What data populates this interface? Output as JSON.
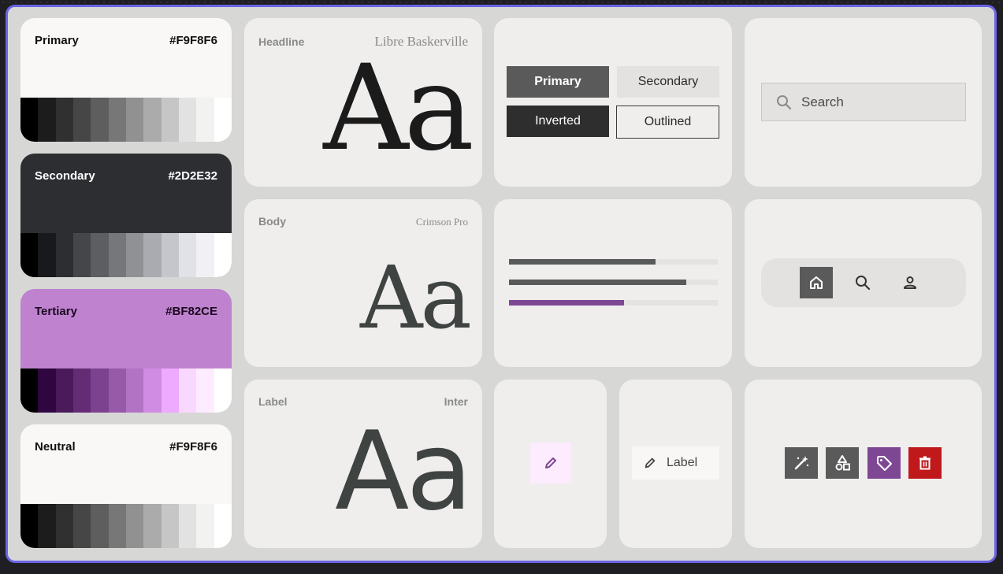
{
  "palettes": [
    {
      "name": "Primary",
      "hex": "#F9F8F6",
      "bg": "#f9f8f6",
      "fg": "#111111",
      "steps": [
        "#000000",
        "#1b1c1b",
        "#2f302f",
        "#464646",
        "#5e5e5e",
        "#777777",
        "#919191",
        "#ababab",
        "#c6c6c6",
        "#e2e2e2",
        "#f2f2f1",
        "#ffffff"
      ]
    },
    {
      "name": "Secondary",
      "hex": "#2D2E32",
      "bg": "#2d2e32",
      "fg": "#ffffff",
      "steps": [
        "#000000",
        "#18191c",
        "#2d2e32",
        "#44464a",
        "#5c5e62",
        "#75777b",
        "#8f9195",
        "#aaabb0",
        "#c5c6cb",
        "#e1e2e7",
        "#f0f0f5",
        "#ffffff"
      ]
    },
    {
      "name": "Tertiary",
      "hex": "#BF82CE",
      "bg": "#bf82ce",
      "fg": "#1a0820",
      "steps": [
        "#000000",
        "#2f0640",
        "#4a1a5a",
        "#632c74",
        "#7d428f",
        "#975aa9",
        "#b273c5",
        "#cf8ce2",
        "#edaaff",
        "#f9d8ff",
        "#fdebff",
        "#ffffff"
      ]
    },
    {
      "name": "Neutral",
      "hex": "#F9F8F6",
      "bg": "#f9f8f6",
      "fg": "#111111",
      "steps": [
        "#000000",
        "#1b1c1b",
        "#2f302f",
        "#464646",
        "#5e5e5e",
        "#777777",
        "#919191",
        "#ababab",
        "#c6c6c6",
        "#e2e2e2",
        "#f2f2f1",
        "#ffffff"
      ]
    }
  ],
  "typography": {
    "headline": {
      "role": "Headline",
      "font": "Libre Baskerville",
      "sample": "Aa"
    },
    "body": {
      "role": "Body",
      "font": "Crimson Pro",
      "sample": "Aa"
    },
    "label": {
      "role": "Label",
      "font": "Inter",
      "sample": "Aa"
    }
  },
  "buttons": {
    "primary": "Primary",
    "secondary": "Secondary",
    "inverted": "Inverted",
    "outlined": "Outlined"
  },
  "search": {
    "placeholder": "Search",
    "icon": "search-icon"
  },
  "progress": [
    {
      "value": 0.7,
      "color": "#5a5a5a"
    },
    {
      "value": 0.85,
      "color": "#5a5a5a"
    },
    {
      "value": 0.55,
      "color": "#7e4794"
    }
  ],
  "nav": {
    "items": [
      "home-icon",
      "search-icon",
      "person-icon"
    ],
    "active": 0
  },
  "chip": {
    "label": "Label",
    "icon": "pencil-icon"
  },
  "fab": {
    "icon": "pencil-icon"
  },
  "icon_buttons": [
    {
      "icon": "magic-wand-icon",
      "color": "#5a5a5a"
    },
    {
      "icon": "shapes-icon",
      "color": "#5a5a5a"
    },
    {
      "icon": "tag-icon",
      "color": "#7e4794"
    },
    {
      "icon": "delete-icon",
      "color": "#c0191c"
    }
  ]
}
